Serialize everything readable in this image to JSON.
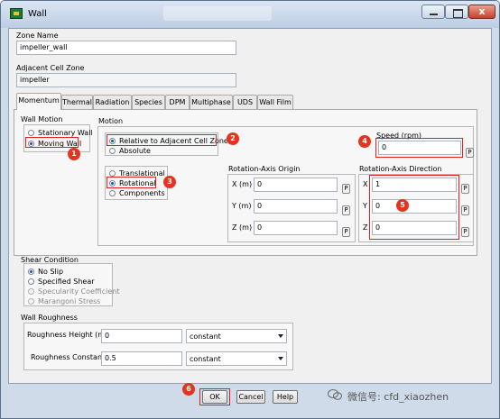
{
  "window": {
    "title": "Wall",
    "close_glyph": "x"
  },
  "zone_name": {
    "label": "Zone Name",
    "value": "impeller_wall"
  },
  "adjacent_cell_zone": {
    "label": "Adjacent Cell Zone",
    "value": "impeller"
  },
  "tabs": [
    {
      "label": "Momentum",
      "active": true
    },
    {
      "label": "Thermal"
    },
    {
      "label": "Radiation"
    },
    {
      "label": "Species"
    },
    {
      "label": "DPM"
    },
    {
      "label": "Multiphase"
    },
    {
      "label": "UDS"
    },
    {
      "label": "Wall Film"
    }
  ],
  "wall_motion": {
    "title": "Wall Motion",
    "options": [
      "Stationary Wall",
      "Moving Wall"
    ],
    "selected": "Moving Wall"
  },
  "motion": {
    "title": "Motion",
    "relative_options": [
      "Relative to Adjacent Cell Zone",
      "Absolute"
    ],
    "type_options": [
      "Translational",
      "Rotational",
      "Components"
    ]
  },
  "speed": {
    "label": "Speed (rpm)",
    "value": "0",
    "p": "P"
  },
  "rotation_axis_origin": {
    "title": "Rotation-Axis Origin",
    "rows": [
      {
        "label": "X (m)",
        "value": "0"
      },
      {
        "label": "Y (m)",
        "value": "0"
      },
      {
        "label": "Z (m)",
        "value": "0"
      }
    ]
  },
  "rotation_axis_direction": {
    "title": "Rotation-Axis Direction",
    "rows": [
      {
        "label": "X",
        "value": "1"
      },
      {
        "label": "Y",
        "value": "0"
      },
      {
        "label": "Z",
        "value": "0"
      }
    ]
  },
  "p_label": "P",
  "shear_condition": {
    "title": "Shear Condition",
    "options": [
      "No Slip",
      "Specified Shear",
      "Specularity Coefficient",
      "Marangoni Stress"
    ]
  },
  "wall_roughness": {
    "title": "Wall Roughness",
    "height_label": "Roughness Height (m)",
    "height_value": "0",
    "height_method": "constant",
    "constant_label": "Roughness Constant",
    "constant_value": "0.5",
    "constant_method": "constant"
  },
  "buttons": {
    "ok": "OK",
    "cancel": "Cancel",
    "help": "Help"
  },
  "badges": [
    "1",
    "2",
    "3",
    "4",
    "5",
    "6"
  ],
  "watermark": "微信号: cfd_xiaozhen",
  "colors": {
    "highlight": "#e02020",
    "badge": "#e53320",
    "titlebar": "#cfdbe9"
  }
}
